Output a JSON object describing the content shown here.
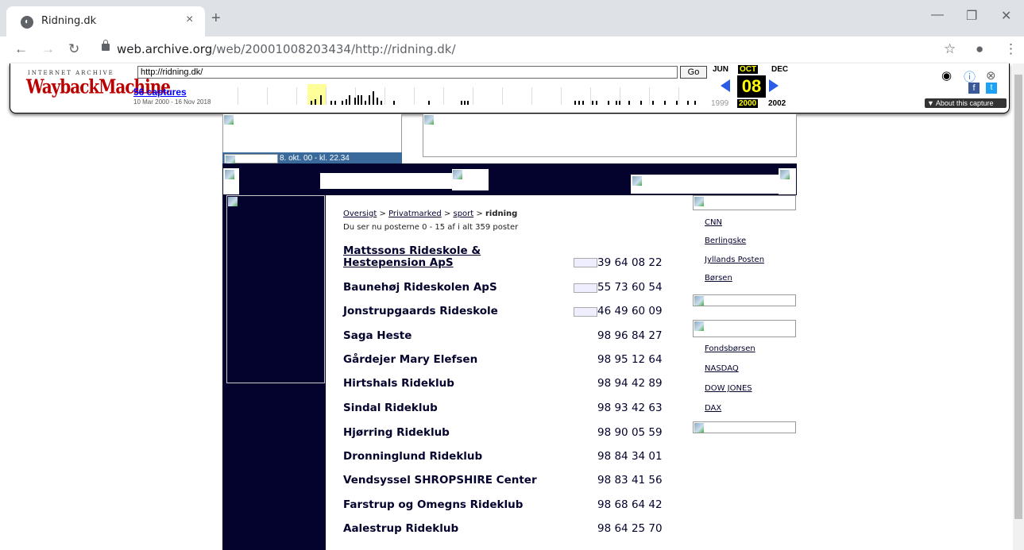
{
  "browser": {
    "tab_title": "Ridning.dk",
    "tab_close": "×",
    "new_tab": "+",
    "url_host": "web.archive.org",
    "url_path": "/web/20001008203434/http://ridning.dk/"
  },
  "wayback": {
    "logo_top": "INTERNET ARCHIVE",
    "logo_bottom": "WaybackMachine",
    "url_value": "http://ridning.dk/",
    "go_label": "Go",
    "captures_label": "56 captures",
    "date_range": "10 Mar 2000 - 16 Nov 2018",
    "months": {
      "prev": "JUN",
      "current": "OCT",
      "next": "DEC"
    },
    "day": "08",
    "years": {
      "prev": "1999",
      "current": "2000",
      "next": "2002"
    },
    "about_label": "▼ About this capture"
  },
  "page": {
    "date_text": "8. okt. 00 - kl. 22.34",
    "breadcrumb": {
      "items": [
        "Oversigt",
        "Privatmarked",
        "sport"
      ],
      "sep": ">",
      "current": "ridning"
    },
    "subinfo": "Du ser nu posterne 0 - 15 af i alt 359 poster",
    "listings": [
      {
        "name": "Mattssons Rideskole & Hestepension ApS",
        "phone": "39 64 08 22",
        "has_img": true,
        "link": true
      },
      {
        "name": "Baunehøj Rideskolen ApS",
        "phone": "55 73 60 54",
        "has_img": true
      },
      {
        "name": "Jonstrupgaards Rideskole",
        "phone": "46 49 60 09",
        "has_img": true
      },
      {
        "name": "Saga Heste",
        "phone": "98 96 84 27"
      },
      {
        "name": "Gårdejer Mary Elefsen",
        "phone": "98 95 12 64"
      },
      {
        "name": "Hirtshals Rideklub",
        "phone": "98 94 42 89"
      },
      {
        "name": "Sindal Rideklub",
        "phone": "98 93 42 63"
      },
      {
        "name": "Hjørring Rideklub",
        "phone": "98 90 05 59"
      },
      {
        "name": "Dronninglund Rideklub",
        "phone": "98 84 34 01"
      },
      {
        "name": "Vendsyssel SHROPSHIRE Center",
        "phone": "98 83 41 56"
      },
      {
        "name": "Farstrup og Omegns Rideklub",
        "phone": "98 68 64 42"
      },
      {
        "name": "Aalestrup Rideklub",
        "phone": "98 64 25 70"
      }
    ],
    "news_links": [
      "CNN",
      "Berlingske",
      "Jyllands Posten",
      "Børsen"
    ],
    "market_links": [
      "Fondsbørsen",
      "NASDAQ",
      "DOW JONES",
      "DAX"
    ]
  }
}
